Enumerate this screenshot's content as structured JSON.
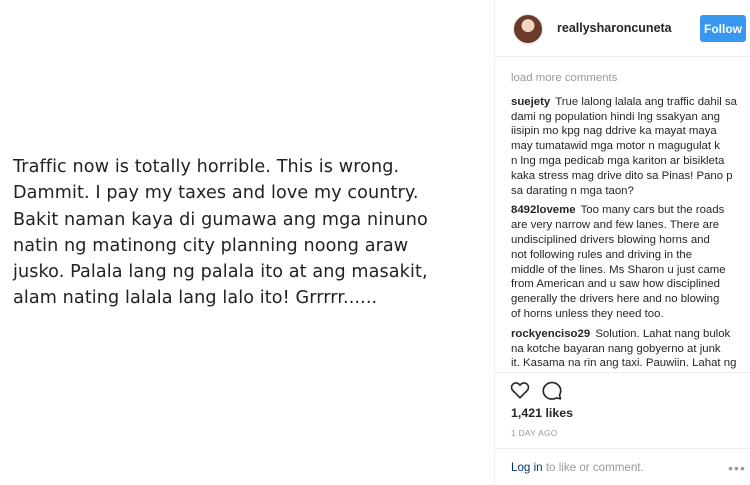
{
  "post_image": {
    "lines": [
      "Traffic now is totally horrible. This is wrong.",
      "Dammit. I pay my taxes and love my country.",
      "Bakit naman kaya di gumawa ang mga ninuno",
      "natin ng matinong city planning noong araw",
      "jusko. Palala lang ng palala ito at ang masakit,",
      "alam nating lalala lang lalo ito! Grrrrr......"
    ]
  },
  "header": {
    "username": "reallysharoncuneta",
    "follow_label": "Follow"
  },
  "comments": {
    "load_more": "load more comments",
    "items": [
      {
        "author": "suejety",
        "lines": [
          "True lalong lalala ang traffic dahil sa",
          "dami ng population hindi lng ssakyan ang",
          "iisipin mo kpg nag ddrive ka mayat maya",
          "may tumatawid mga motor n magugulat k",
          "n lng mga pedicab mga kariton ar bisikleta",
          "kaka stress mag drive dito sa Pinas! Pano p",
          "sa darating n mga taon?"
        ]
      },
      {
        "author": "8492loveme",
        "lines": [
          "Too many cars but the roads",
          "are very narrow and few lanes. There are",
          "undisciplined drivers blowing horns and",
          "not following rules and driving in the",
          "middle of the lines. Ms Sharon u just came",
          "from American and u saw how disciplined",
          "generally the drivers here and no blowing",
          "of horns unless they need too."
        ]
      },
      {
        "author": "rockyenciso29",
        "lines": [
          "Solution. Lahat nang bulok",
          "na kotche bayaran nang gobyerno at junk",
          "it. Kasama na rin ang taxi. Pauwiin. Lahat ng"
        ]
      }
    ]
  },
  "actions": {
    "heart_icon": "heart-icon",
    "comment_icon": "comment-bubble-icon",
    "likes": "1,421 likes",
    "timestamp": "1 DAY AGO"
  },
  "footer": {
    "login_link": "Log in",
    "login_suffix": " to like or comment.",
    "more_icon": "more-options-icon"
  },
  "colors": {
    "follow_button": "#3897f0",
    "muted_text": "#999999",
    "link": "#003569",
    "divider": "#efefef"
  }
}
